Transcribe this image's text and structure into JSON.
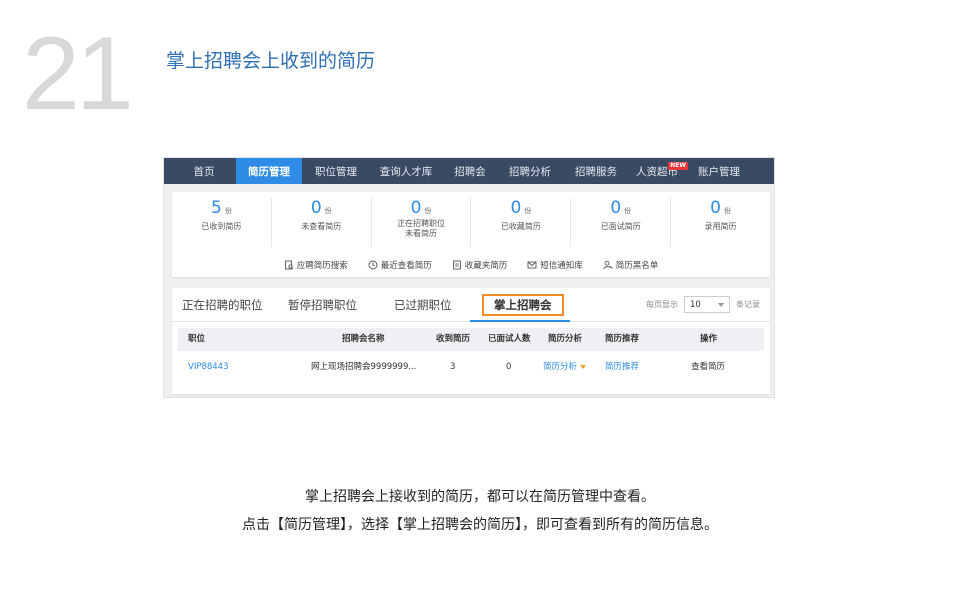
{
  "slide": {
    "number": "21",
    "title": "掌上招聘会上收到的简历",
    "caption_line1": "掌上招聘会上接收到的简历，都可以在简历管理中查看。",
    "caption_line2": "点击【简历管理】，选择【掌上招聘会的简历】，即可查看到所有的简历信息。"
  },
  "nav": {
    "items": [
      "首页",
      "简历管理",
      "职位管理",
      "查询人才库",
      "招聘会",
      "招聘分析",
      "招聘服务",
      "人资超市",
      "账户管理"
    ],
    "active_index": 1,
    "badge": "NEW"
  },
  "stats": [
    {
      "value": "5",
      "unit": "份",
      "label": "已收到简历"
    },
    {
      "value": "0",
      "unit": "份",
      "label": "未查看简历"
    },
    {
      "value": "0",
      "unit": "份",
      "label": "正在招聘职位",
      "label2": "未看简历"
    },
    {
      "value": "0",
      "unit": "份",
      "label": "已收藏简历"
    },
    {
      "value": "0",
      "unit": "份",
      "label": "已面试简历"
    },
    {
      "value": "0",
      "unit": "份",
      "label": "录用简历"
    }
  ],
  "quicklinks": [
    {
      "label": "应聘简历搜索",
      "icon": "file-search-icon"
    },
    {
      "label": "最近查看简历",
      "icon": "clock-icon"
    },
    {
      "label": "收藏夹简历",
      "icon": "folder-icon"
    },
    {
      "label": "短信通知库",
      "icon": "message-icon"
    },
    {
      "label": "简历黑名单",
      "icon": "user-block-icon"
    }
  ],
  "tabs": [
    "正在招聘的职位",
    "暂停招聘职位",
    "已过期职位",
    "掌上招聘会"
  ],
  "selected_tab": 3,
  "pager": {
    "prefix": "每页显示",
    "value": "10",
    "suffix": "条记录"
  },
  "table": {
    "headers": [
      "职位",
      "招聘会名称",
      "收到简历",
      "已面试人数",
      "简历分析",
      "简历推荐",
      "操作"
    ],
    "rows": [
      [
        "VIP88443",
        "网上现场招聘会9999999...",
        "3",
        "0",
        "简历分析",
        "简历推荐",
        "查看简历"
      ]
    ]
  },
  "colors": {
    "accent": "#2e8be6",
    "nav_bg": "#3a4a63",
    "highlight": "#f08a24",
    "title": "#2f6fb5"
  }
}
